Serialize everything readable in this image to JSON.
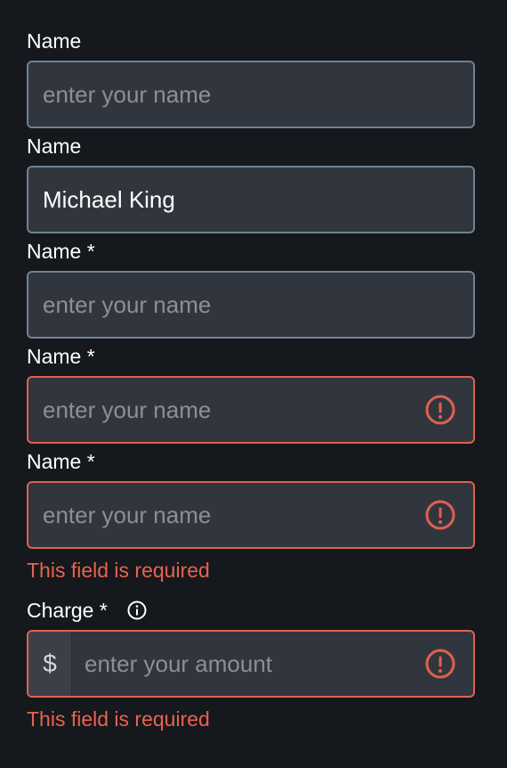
{
  "fields": [
    {
      "label": "Name",
      "placeholder": "enter your name",
      "value": ""
    },
    {
      "label": "Name",
      "placeholder": "enter your name",
      "value": "Michael King"
    },
    {
      "label": "Name *",
      "placeholder": "enter your name",
      "value": ""
    },
    {
      "label": "Name *",
      "placeholder": "enter your name",
      "value": ""
    },
    {
      "label": "Name *",
      "placeholder": "enter your name",
      "value": "",
      "error": "This field is required"
    }
  ],
  "charge": {
    "label": "Charge *",
    "prefix": "$",
    "placeholder": "enter your amount",
    "value": "",
    "error": "This field is required"
  },
  "icons": {
    "error": "exclamation-circle-icon",
    "info": "info-circle-icon"
  },
  "colors": {
    "background": "#15181c",
    "input_bg": "#31363e",
    "border": "#6f8293",
    "error": "#e0604f",
    "placeholder": "#8b9097"
  }
}
